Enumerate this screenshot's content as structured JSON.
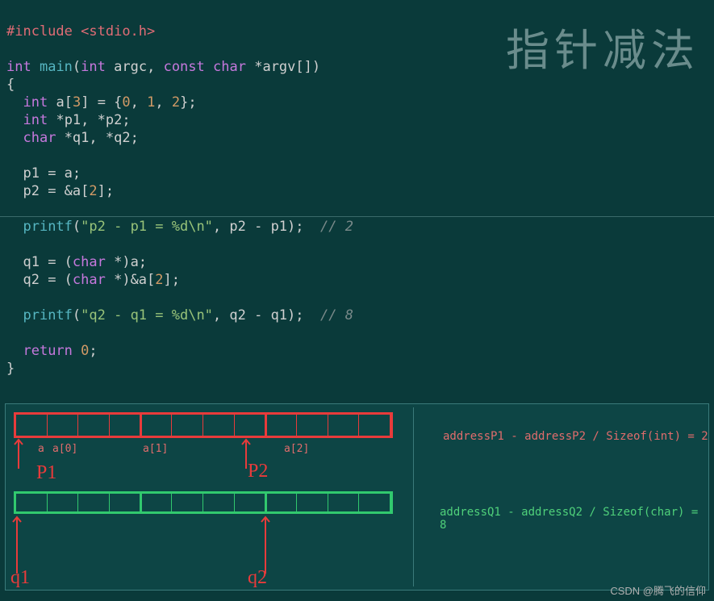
{
  "title_cn": "指针减法",
  "code": {
    "include_kw": "#include",
    "include_hdr": "<stdio.h>",
    "line_empty": "",
    "main_type": "int",
    "main_fn": "main",
    "main_args_open": "(",
    "arg_int": "int",
    "arg_argc": "argc",
    "arg_comma": ", ",
    "arg_const": "const",
    "arg_char": "char",
    "arg_star_argv": "*argv[]",
    "main_args_close": ")",
    "brace_open": "{",
    "decl_int": "int",
    "decl_a": "a",
    "arr_open": "[",
    "arr_size": "3",
    "arr_close": "]",
    "eq": " = ",
    "init_open": "{",
    "v0": "0",
    "v1": "1",
    "v2": "2",
    "init_close": "}",
    "semi": ";",
    "decl_p1p2": "*p1, *p2",
    "char_kw": "char",
    "decl_q1q2": "*q1, *q2",
    "p1_assign": "p1 = a;",
    "p2_prefix": "p2 = &a[",
    "p2_idx": "2",
    "p2_suffix": "];",
    "printf": "printf",
    "str_p": "\"p2 - p1 = %d\\n\"",
    "args_p": ", p2 - p1);",
    "cmt_2": "// 2",
    "q1_cast": "q1 = (",
    "char_cast": "char",
    "q1_rest": " *)a;",
    "q2_cast": "q2 = (",
    "q2_rest": " *)&a[",
    "q2_idx": "2",
    "q2_end": "];",
    "str_q": "\"q2 - q1 = %d\\n\"",
    "args_q": ", q2 - q1);",
    "cmt_8": "// 8",
    "return_kw": "return",
    "ret_val": "0",
    "brace_close": "}"
  },
  "diagram": {
    "a_label": "a",
    "a0": "a[0]",
    "a1": "a[1]",
    "a2": "a[2]",
    "p1": "P1",
    "p2": "P2",
    "q1": "q1",
    "q2": "q2",
    "desc_int": "addressP1 - addressP2 / Sizeof(int) = 2",
    "desc_char": "addressQ1 - addressQ2 / Sizeof(char) = 8"
  },
  "watermark": "CSDN @腾飞的信仰"
}
